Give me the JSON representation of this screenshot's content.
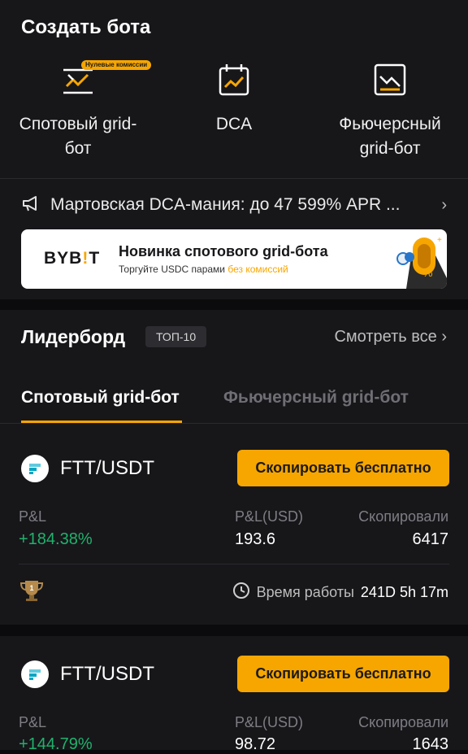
{
  "create": {
    "title": "Создать бота",
    "bots": [
      {
        "label_line1": "Спотовый grid-",
        "label_line2": "бот",
        "icon": "spot-grid-icon",
        "badge": "Нулевые комиссии"
      },
      {
        "label_line1": "DCA",
        "label_line2": "",
        "icon": "dca-calendar-icon"
      },
      {
        "label_line1": "Фьючерсный",
        "label_line2": "grid-бот",
        "icon": "futures-grid-icon"
      }
    ],
    "promo_text": "Мартовская DCA-мания: до 47 599% APR ...",
    "banner": {
      "logo_a": "BYB",
      "logo_bar": "!",
      "logo_b": "T",
      "headline": "Новинка спотового grid-бота",
      "sub_prefix": "Торгуйте USDC парами ",
      "sub_highlight": "без комиссий",
      "percent": "%"
    }
  },
  "leaderboard": {
    "title": "Лидерборд",
    "badge": "ТОП-10",
    "see_all": "Смотреть все",
    "tabs": [
      "Спотовый grid-бот",
      "Фьючерсный grid-бот"
    ],
    "active_tab": 0
  },
  "cards": [
    {
      "pair": "FTT/USDT",
      "copy_label": "Скопировать бесплатно",
      "pnl_label": "P&L",
      "pnl": "+184.38%",
      "pnl_usd_label": "P&L(USD)",
      "pnl_usd": "193.6",
      "copied_label": "Скопировали",
      "copied": "6417",
      "runtime_label": "Время работы",
      "runtime": "241D 5h 17m",
      "rank": "1"
    },
    {
      "pair": "FTT/USDT",
      "copy_label": "Скопировать бесплатно",
      "pnl_label": "P&L",
      "pnl": "+144.79%",
      "pnl_usd_label": "P&L(USD)",
      "pnl_usd": "98.72",
      "copied_label": "Скопировали",
      "copied": "1643"
    }
  ],
  "colors": {
    "accent": "#f7a600",
    "positive": "#20b26c",
    "panel": "#17171a",
    "background": "#0b0b0d"
  }
}
